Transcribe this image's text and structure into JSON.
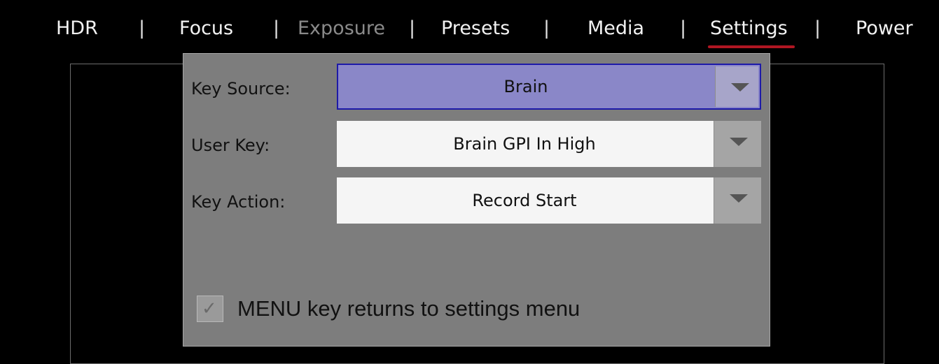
{
  "nav": {
    "items": [
      {
        "label": "HDR"
      },
      {
        "label": "Focus"
      },
      {
        "label": "Exposure"
      },
      {
        "label": "Presets"
      },
      {
        "label": "Media"
      },
      {
        "label": "Settings"
      },
      {
        "label": "Power"
      }
    ],
    "separator": "|",
    "active": "Settings",
    "disabled": "Exposure",
    "accent_color": "#b01622"
  },
  "dialog": {
    "fields": [
      {
        "label": "Key Source:",
        "value": "Brain"
      },
      {
        "label": "User Key:",
        "value": "Brain GPI In High"
      },
      {
        "label": "Key Action:",
        "value": "Record Start"
      }
    ],
    "checkbox": {
      "label": "MENU key returns to settings menu",
      "checked": true,
      "glyph": "✓"
    },
    "dropdown_icon": "triangle-down-icon",
    "selected_color": "#8a87c8"
  }
}
